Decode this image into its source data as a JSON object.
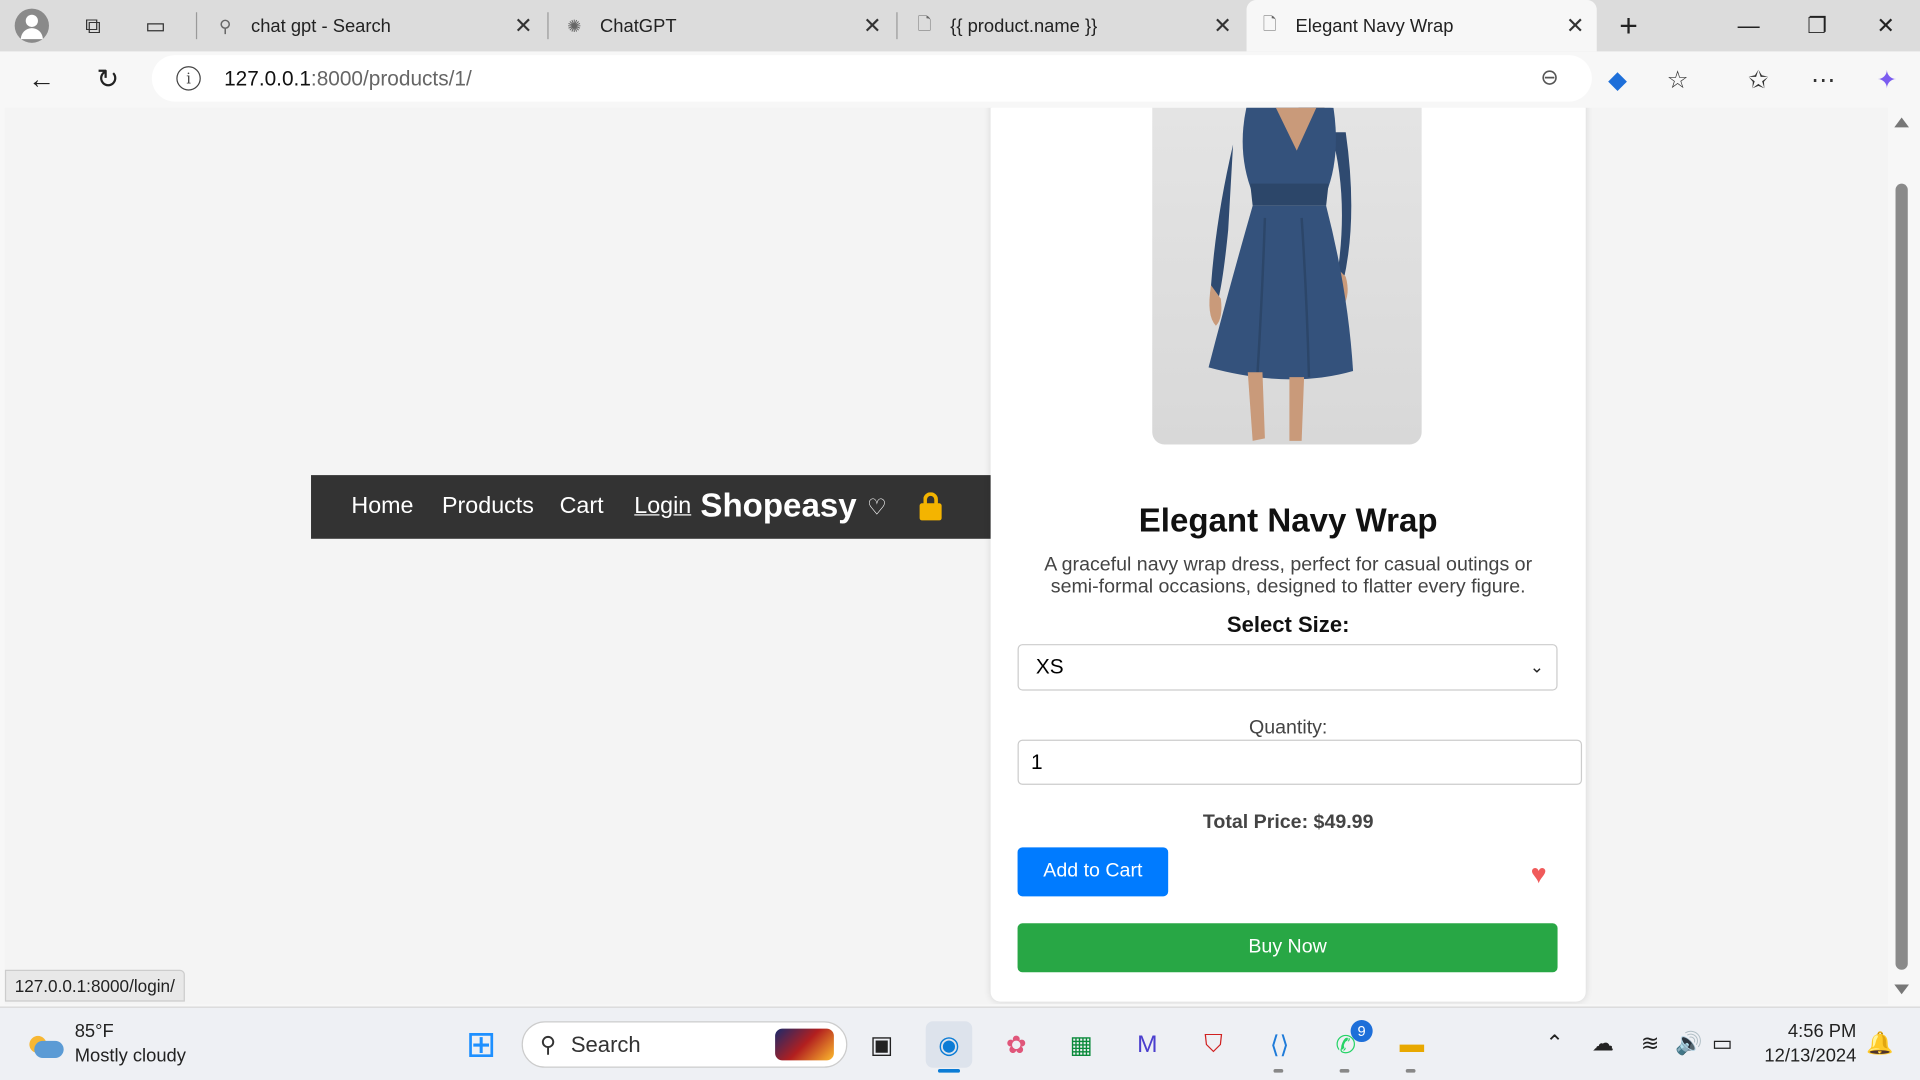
{
  "browser": {
    "tabs": [
      {
        "title": "chat gpt - Search",
        "icon": "search-icon"
      },
      {
        "title": "ChatGPT",
        "icon": "openai-icon"
      },
      {
        "title": "{{ product.name }}",
        "icon": "page-icon"
      },
      {
        "title": "Elegant Navy Wrap",
        "icon": "page-icon",
        "active": true
      }
    ],
    "url_host": "127.0.0.1",
    "url_path": ":8000/products/1/",
    "status_url": "127.0.0.1:8000/login/"
  },
  "shop": {
    "nav": {
      "home": "Home",
      "products": "Products",
      "cart": "Cart",
      "login": "Login",
      "brand": "Shopeasy",
      "heart": "♡"
    },
    "product": {
      "name": "Elegant Navy Wrap",
      "description": "A graceful navy wrap dress, perfect for casual outings or semi-formal occasions, designed to flatter every figure.",
      "size_label": "Select Size:",
      "size_value": "XS",
      "quantity_label": "Quantity:",
      "quantity_value": "1",
      "total_price": "Total Price: $49.99",
      "add_to_cart": "Add to Cart",
      "buy_now": "Buy Now",
      "wishlist_heart": "♥"
    },
    "colors": {
      "nav_bg": "#333333",
      "add_btn": "#007bff",
      "buy_btn": "#28a745",
      "heart": "#f05a5a"
    }
  },
  "taskbar": {
    "temperature": "85°F",
    "weather": "Mostly cloudy",
    "search_placeholder": "Search",
    "whatsapp_badge": "9",
    "time": "4:56 PM",
    "date": "12/13/2024"
  }
}
